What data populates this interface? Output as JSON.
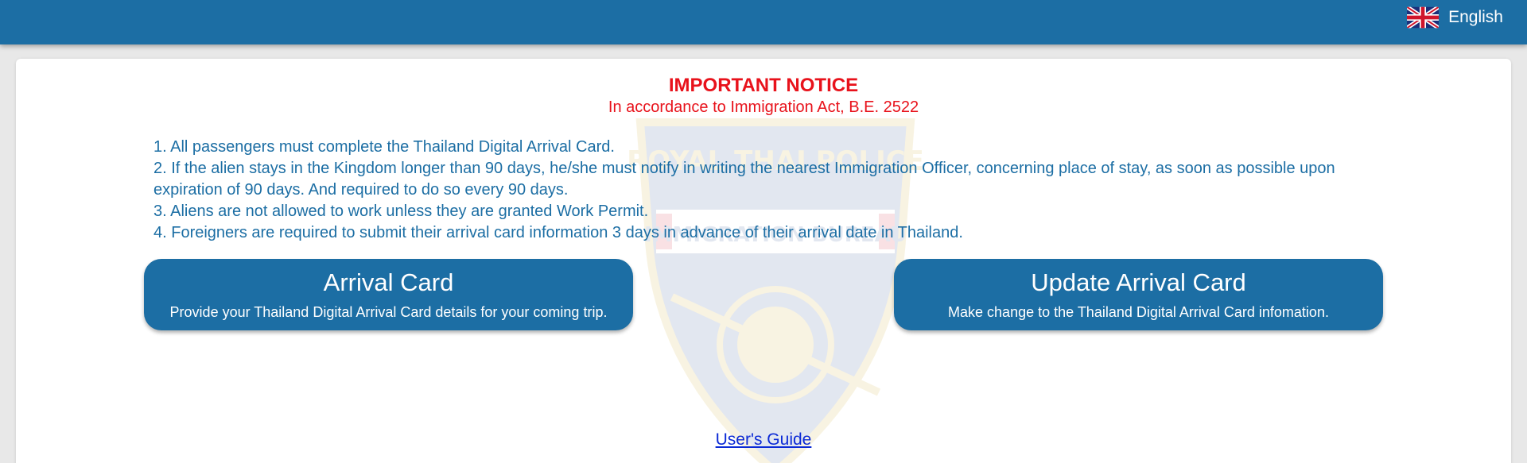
{
  "header": {
    "language_label": "English",
    "language_icon": "uk-flag-icon",
    "bar_color": "#1c6ea4"
  },
  "notice": {
    "title": "IMPORTANT NOTICE",
    "subtitle": "In accordance to Immigration Act, B.E. 2522",
    "title_color": "#e8121b",
    "items": [
      "1. All passengers must complete the Thailand Digital Arrival Card.",
      "2. If the alien stays in the Kingdom longer than 90 days, he/she must notify in writing the nearest Immigration Officer, concerning place of stay, as soon as possible upon expiration of 90 days. And required to do so every 90 days.",
      "3. Aliens are not allowed to work unless they are granted Work Permit.",
      "4. Foreigners are required to submit their arrival card information 3 days in advance of their arrival date in Thailand."
    ]
  },
  "actions": {
    "arrival": {
      "title": "Arrival Card",
      "description": "Provide your Thailand Digital Arrival Card details for your coming trip."
    },
    "update": {
      "title": "Update Arrival Card",
      "description": "Make change to the Thailand Digital Arrival Card infomation."
    }
  },
  "watermark": {
    "icon": "immigration-bureau-badge-icon",
    "text_top": "ROYAL THAI POLICE",
    "text_middle": "IMMIGRATION BUREAU"
  },
  "footer": {
    "guide_label": "User's Guide"
  }
}
